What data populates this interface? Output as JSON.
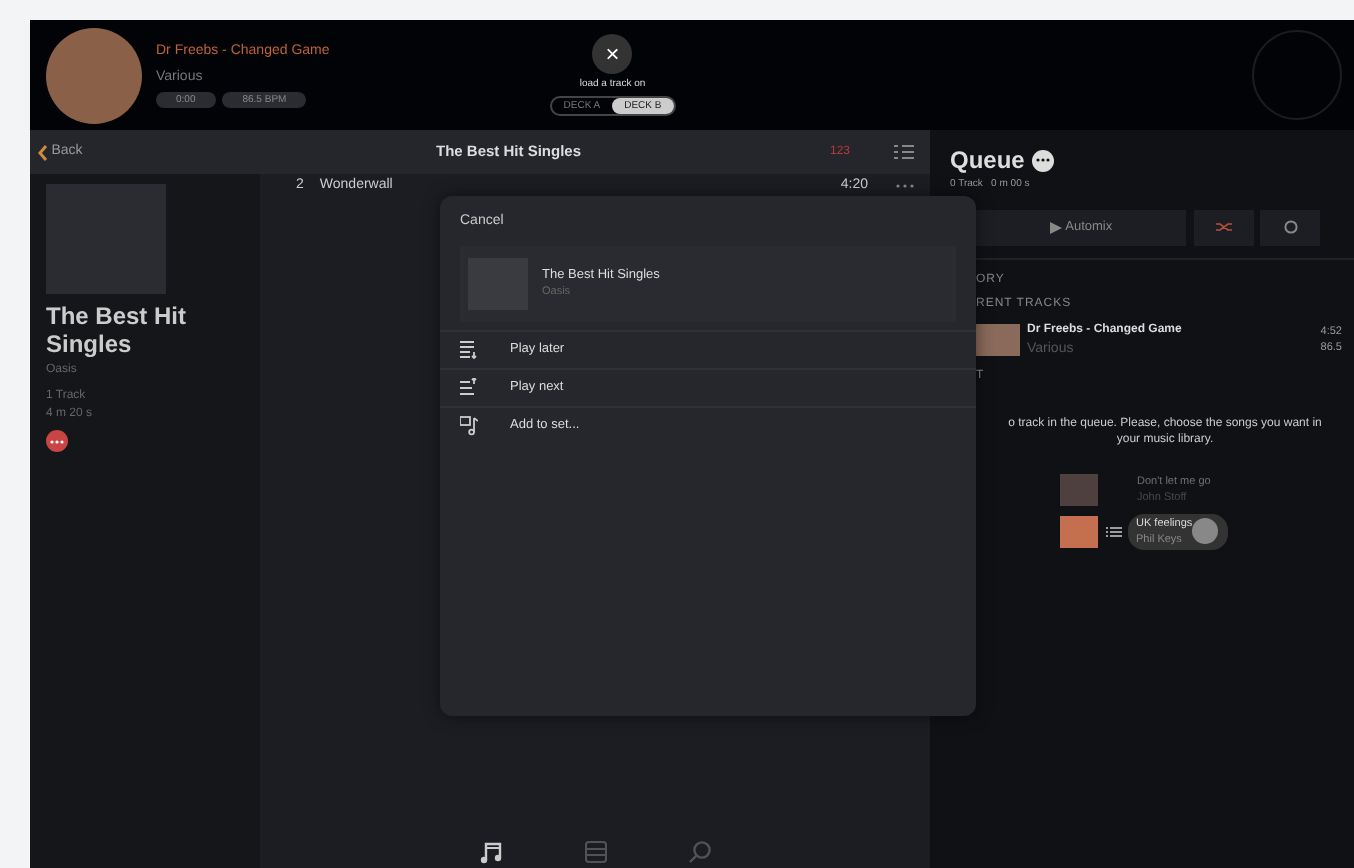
{
  "now_playing": {
    "title": "Dr Freebs - Changed Game",
    "artist": "Various",
    "pills": [
      "0:00",
      "86.5 BPM"
    ]
  },
  "deck_loader": {
    "close": "×",
    "label": "load a track on",
    "decks": [
      {
        "label": "DECK A",
        "selected": false
      },
      {
        "label": "DECK B",
        "selected": true
      }
    ]
  },
  "nav": {
    "back": "Back",
    "title": "The Best Hit Singles",
    "count": "123"
  },
  "album": {
    "title": "The Best Hit Singles",
    "artist": "Oasis",
    "tracks": "1 Track",
    "duration": "4 m 20 s"
  },
  "tracks": [
    {
      "number": "2",
      "title": "Wonderwall",
      "duration": "4:20"
    }
  ],
  "sheet": {
    "cancel": "Cancel",
    "title": "The Best Hit Singles",
    "artist": "Oasis",
    "actions": [
      {
        "kind": "later",
        "label": "Play later"
      },
      {
        "kind": "next",
        "label": "Play next"
      },
      {
        "kind": "set",
        "label": "Add to set..."
      }
    ]
  },
  "queue": {
    "title": "Queue",
    "summary": "0 Track   0 m 00 s",
    "automix": "Automix",
    "history": "ORY",
    "current_heading": "RENT TRACKS",
    "current": [
      {
        "title": "Dr Freebs - Changed Game",
        "artist": "Various",
        "duration": "4:52",
        "bpm": "86.5"
      }
    ],
    "next_heading": "T",
    "empty_message": [
      "o track in the queue. Please, choose the songs you want in",
      "your music library."
    ],
    "suggestions": [
      {
        "title": "Don't let me go",
        "artist": "John Stoff",
        "highlighted": false
      },
      {
        "title": "UK feelings",
        "artist": "Phil Keys",
        "highlighted": true
      }
    ]
  },
  "bottom_tabs": [
    {
      "kind": "music",
      "selected": true
    },
    {
      "kind": "sets",
      "selected": false
    },
    {
      "kind": "search",
      "selected": false
    }
  ]
}
